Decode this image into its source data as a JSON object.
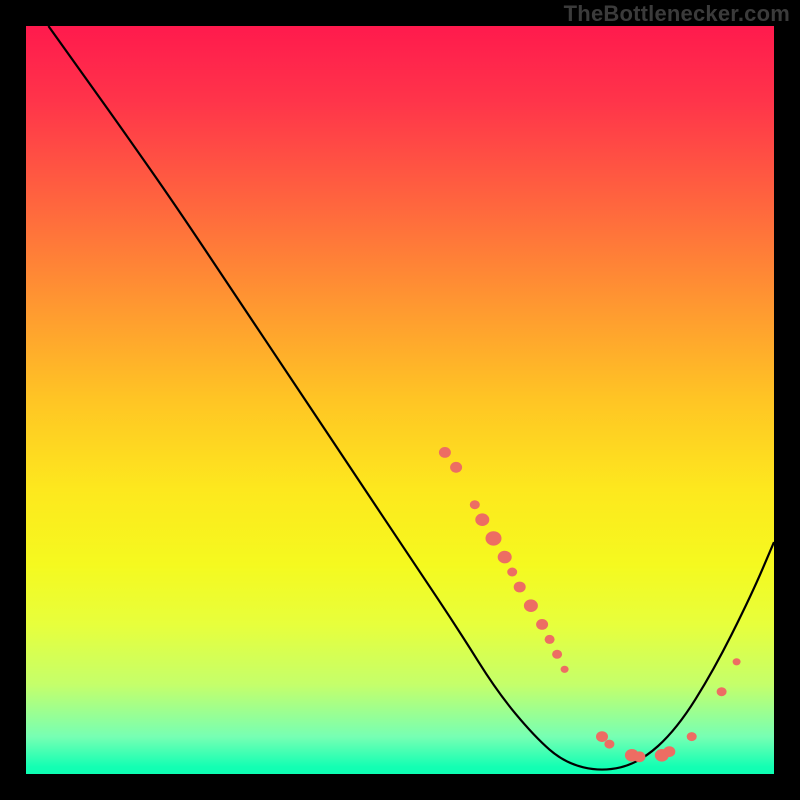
{
  "attribution": "TheBottlenecker.com",
  "colors": {
    "curve": "#000000",
    "dot": "#ed6d63",
    "background_black": "#000000"
  },
  "chart_data": {
    "type": "line",
    "title": "",
    "xlabel": "",
    "ylabel": "",
    "xlim": [
      0,
      100
    ],
    "ylim": [
      0,
      100
    ],
    "curve": [
      {
        "x": 3,
        "y": 100
      },
      {
        "x": 8,
        "y": 93
      },
      {
        "x": 13,
        "y": 86
      },
      {
        "x": 20,
        "y": 76
      },
      {
        "x": 28,
        "y": 64
      },
      {
        "x": 36,
        "y": 52
      },
      {
        "x": 44,
        "y": 40
      },
      {
        "x": 52,
        "y": 28
      },
      {
        "x": 58,
        "y": 19
      },
      {
        "x": 63,
        "y": 11
      },
      {
        "x": 68,
        "y": 5
      },
      {
        "x": 72,
        "y": 1.5
      },
      {
        "x": 77,
        "y": 0.3
      },
      {
        "x": 82,
        "y": 1.5
      },
      {
        "x": 87,
        "y": 6
      },
      {
        "x": 92,
        "y": 14
      },
      {
        "x": 97,
        "y": 24
      },
      {
        "x": 100,
        "y": 31
      }
    ],
    "dots": [
      {
        "x": 56,
        "y": 43,
        "r": 6
      },
      {
        "x": 57.5,
        "y": 41,
        "r": 6
      },
      {
        "x": 60,
        "y": 36,
        "r": 5
      },
      {
        "x": 61,
        "y": 34,
        "r": 7
      },
      {
        "x": 62.5,
        "y": 31.5,
        "r": 8
      },
      {
        "x": 64,
        "y": 29,
        "r": 7
      },
      {
        "x": 65,
        "y": 27,
        "r": 5
      },
      {
        "x": 66,
        "y": 25,
        "r": 6
      },
      {
        "x": 67.5,
        "y": 22.5,
        "r": 7
      },
      {
        "x": 69,
        "y": 20,
        "r": 6
      },
      {
        "x": 70,
        "y": 18,
        "r": 5
      },
      {
        "x": 71,
        "y": 16,
        "r": 5
      },
      {
        "x": 72,
        "y": 14,
        "r": 4
      },
      {
        "x": 77,
        "y": 5,
        "r": 6
      },
      {
        "x": 78,
        "y": 4,
        "r": 5
      },
      {
        "x": 81,
        "y": 2.5,
        "r": 7
      },
      {
        "x": 82,
        "y": 2.3,
        "r": 6
      },
      {
        "x": 85,
        "y": 2.5,
        "r": 7
      },
      {
        "x": 86,
        "y": 3,
        "r": 6
      },
      {
        "x": 89,
        "y": 5,
        "r": 5
      },
      {
        "x": 93,
        "y": 11,
        "r": 5
      },
      {
        "x": 95,
        "y": 15,
        "r": 4
      }
    ]
  }
}
